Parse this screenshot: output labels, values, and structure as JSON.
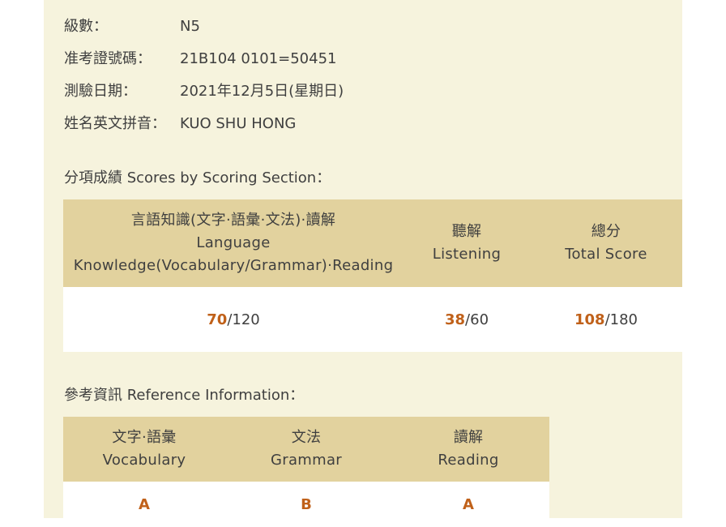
{
  "info": {
    "level_label": "級數：",
    "level_value": "N5",
    "exam_no_label": "准考證號碼：",
    "exam_no_value": "21B104 0101=50451",
    "date_label": "測驗日期：",
    "date_value": "2021年12月5日(星期日)",
    "name_label": "姓名英文拼音：",
    "name_value": "KUO SHU HONG"
  },
  "scores_section": {
    "title": "分項成績 Scores by Scoring Section：",
    "headers": [
      {
        "line1": "言語知識(文字·語彙·文法)·讀解",
        "line2": "Language",
        "line3": "Knowledge(Vocabulary/Grammar)·Reading"
      },
      {
        "line1": "聽解",
        "line2": "Listening"
      },
      {
        "line1": "總分",
        "line2": "Total Score"
      }
    ],
    "values": [
      {
        "score": "70",
        "max": "/120"
      },
      {
        "score": "38",
        "max": "/60"
      },
      {
        "score": "108",
        "max": "/180"
      }
    ]
  },
  "reference_section": {
    "title": "參考資訊 Reference Information：",
    "headers": [
      {
        "line1": "文字·語彙",
        "line2": "Vocabulary"
      },
      {
        "line1": "文法",
        "line2": "Grammar"
      },
      {
        "line1": "讀解",
        "line2": "Reading"
      }
    ],
    "grades": [
      "A",
      "B",
      "A"
    ]
  },
  "colors": {
    "panel_background": "#f6f3dd",
    "header_background": "#e2d29e",
    "score_accent": "#c0611a",
    "text": "#3f3f3f"
  }
}
